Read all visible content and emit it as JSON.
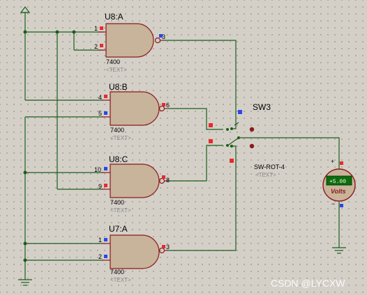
{
  "gates": [
    {
      "name": "U8:A",
      "part": "7400",
      "text": "<TEXT>",
      "pin_in1": "1",
      "pin_in2": "2",
      "pin_out": "3"
    },
    {
      "name": "U8:B",
      "part": "7400",
      "text": "<TEXT>",
      "pin_in1": "4",
      "pin_in2": "5",
      "pin_out": "6"
    },
    {
      "name": "U8:C",
      "part": "7400",
      "text": "<TEXT>",
      "pin_in1": "10",
      "pin_in2": "9",
      "pin_out": "8"
    },
    {
      "name": "U7:A",
      "part": "7400",
      "text": "<TEXT>",
      "pin_in1": "1",
      "pin_in2": "2",
      "pin_out": "3"
    }
  ],
  "switch": {
    "name": "SW3",
    "part": "SW-ROT-4",
    "text": "<TEXT>"
  },
  "voltmeter": {
    "display": "+5.00",
    "unit": "Volts",
    "plus": "+",
    "minus": "−"
  },
  "watermark": "CSDN @LYCXW",
  "colors": {
    "wire": "#1b5e1b",
    "gate_fill": "#c8b39b",
    "gate_stroke": "#8b1a1a",
    "pin_high": "#e62b2b",
    "pin_low": "#2b47e6",
    "background": "#d4d0c8"
  }
}
